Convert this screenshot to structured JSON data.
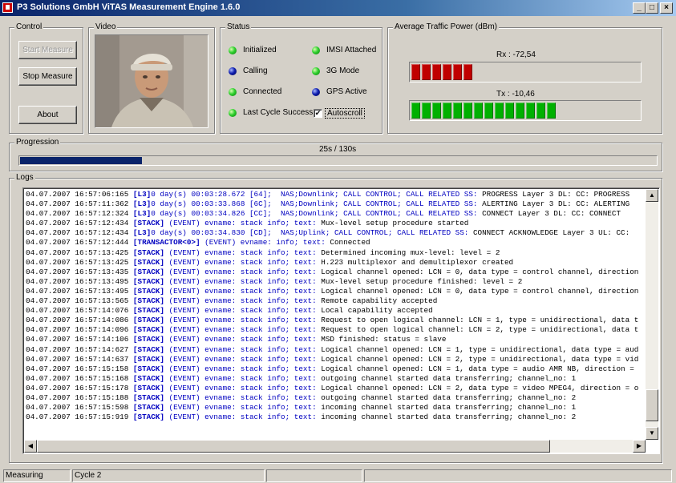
{
  "window": {
    "title": "P3 Solutions GmbH  ViTAS Measurement Engine 1.6.0",
    "controls": [
      "_",
      "□",
      "×"
    ]
  },
  "control": {
    "legend": "Control",
    "start_label": "Start Measure",
    "stop_label": "Stop Measure",
    "about_label": "About"
  },
  "video": {
    "legend": "Video"
  },
  "status": {
    "legend": "Status",
    "items": [
      {
        "label": "Initialized",
        "color": "green"
      },
      {
        "label": "Calling",
        "color": "blue"
      },
      {
        "label": "Connected",
        "color": "green"
      },
      {
        "label": "Last Cycle Success",
        "color": "green"
      },
      {
        "label": "IMSI Attached",
        "color": "green"
      },
      {
        "label": "3G Mode",
        "color": "green"
      },
      {
        "label": "GPS Active",
        "color": "blue"
      }
    ],
    "autoscroll_label": "Autoscroll",
    "autoscroll_checked": true
  },
  "power": {
    "legend": "Average Traffic Power (dBm)",
    "rx_label": "Rx : -72,54",
    "rx_segments": 6,
    "tx_label": "Tx : -10,46",
    "tx_segments": 14,
    "total_segments": 21,
    "rx_color": "#c00000",
    "tx_color": "#00b000"
  },
  "progression": {
    "legend": "Progression",
    "text": "25s / 130s",
    "fraction": 0.192
  },
  "logs": {
    "legend": "Logs",
    "lines": [
      {
        "ts": "04.07.2007 16:57:06:165",
        "tag": "[L3]",
        "ev": "0 day(s) 00:03:28.672 [64];  NAS;Downlink; CALL CONTROL; CALL RELATED SS:",
        "txt": " PROGRESS Layer 3 DL: CC: PROGRESS"
      },
      {
        "ts": "04.07.2007 16:57:11:362",
        "tag": "[L3]",
        "ev": "0 day(s) 00:03:33.868 [6C];  NAS;Downlink; CALL CONTROL; CALL RELATED SS:",
        "txt": " ALERTING Layer 3 DL: CC: ALERTING"
      },
      {
        "ts": "04.07.2007 16:57:12:324",
        "tag": "[L3]",
        "ev": "0 day(s) 00:03:34.826 [CC];  NAS;Downlink; CALL CONTROL; CALL RELATED SS:",
        "txt": " CONNECT Layer 3 DL: CC: CONNECT"
      },
      {
        "ts": "04.07.2007 16:57:12:434",
        "tag": "[STACK]",
        "ev": " (EVENT) evname: stack info; text:",
        "txt": " Mux-level setup procedure started"
      },
      {
        "ts": "04.07.2007 16:57:12:434",
        "tag": "[L3]",
        "ev": "0 day(s) 00:03:34.830 [CD];  NAS;Uplink; CALL CONTROL; CALL RELATED SS:",
        "txt": " CONNECT ACKNOWLEDGE Layer 3 UL: CC:"
      },
      {
        "ts": "04.07.2007 16:57:12:444",
        "tag": "[TRANSACTOR<0>]",
        "ev": " (EVENT) evname: info; text:",
        "txt": " Connected"
      },
      {
        "ts": "04.07.2007 16:57:13:425",
        "tag": "[STACK]",
        "ev": " (EVENT) evname: stack info; text:",
        "txt": " Determined incoming mux-level: level = 2"
      },
      {
        "ts": "04.07.2007 16:57:13:425",
        "tag": "[STACK]",
        "ev": " (EVENT) evname: stack info; text:",
        "txt": " H.223 multiplexor and demultiplexor created"
      },
      {
        "ts": "04.07.2007 16:57:13:435",
        "tag": "[STACK]",
        "ev": " (EVENT) evname: stack info; text:",
        "txt": " Logical channel opened: LCN = 0, data type = control channel, direction"
      },
      {
        "ts": "04.07.2007 16:57:13:495",
        "tag": "[STACK]",
        "ev": " (EVENT) evname: stack info; text:",
        "txt": " Mux-level setup procedure finished: level = 2"
      },
      {
        "ts": "04.07.2007 16:57:13:495",
        "tag": "[STACK]",
        "ev": " (EVENT) evname: stack info; text:",
        "txt": " Logical channel opened: LCN = 0, data type = control channel, direction"
      },
      {
        "ts": "04.07.2007 16:57:13:565",
        "tag": "[STACK]",
        "ev": " (EVENT) evname: stack info; text:",
        "txt": " Remote capability accepted"
      },
      {
        "ts": "04.07.2007 16:57:14:076",
        "tag": "[STACK]",
        "ev": " (EVENT) evname: stack info; text:",
        "txt": " Local capability accepted"
      },
      {
        "ts": "04.07.2007 16:57:14:086",
        "tag": "[STACK]",
        "ev": " (EVENT) evname: stack info; text:",
        "txt": " Request to open logical channel: LCN = 1, type = unidirectional, data t"
      },
      {
        "ts": "04.07.2007 16:57:14:096",
        "tag": "[STACK]",
        "ev": " (EVENT) evname: stack info; text:",
        "txt": " Request to open logical channel: LCN = 2, type = unidirectional, data t"
      },
      {
        "ts": "04.07.2007 16:57:14:106",
        "tag": "[STACK]",
        "ev": " (EVENT) evname: stack info; text:",
        "txt": " MSD finished: status = slave"
      },
      {
        "ts": "04.07.2007 16:57:14:627",
        "tag": "[STACK]",
        "ev": " (EVENT) evname: stack info; text:",
        "txt": " Logical channel opened: LCN = 1, type = unidirectional, data type = aud"
      },
      {
        "ts": "04.07.2007 16:57:14:637",
        "tag": "[STACK]",
        "ev": " (EVENT) evname: stack info; text:",
        "txt": " Logical channel opened: LCN = 2, type = unidirectional, data type = vid"
      },
      {
        "ts": "04.07.2007 16:57:15:158",
        "tag": "[STACK]",
        "ev": " (EVENT) evname: stack info; text:",
        "txt": " Logical channel opened: LCN = 1, data type = audio AMR NB, direction ="
      },
      {
        "ts": "04.07.2007 16:57:15:168",
        "tag": "[STACK]",
        "ev": " (EVENT) evname: stack info; text:",
        "txt": " outgoing channel started data transferring; channel_no: 1"
      },
      {
        "ts": "04.07.2007 16:57:15:178",
        "tag": "[STACK]",
        "ev": " (EVENT) evname: stack info; text:",
        "txt": " Logical channel opened: LCN = 2, data type = video MPEG4, direction = o"
      },
      {
        "ts": "04.07.2007 16:57:15:188",
        "tag": "[STACK]",
        "ev": " (EVENT) evname: stack info; text:",
        "txt": " outgoing channel started data transferring; channel_no: 2"
      },
      {
        "ts": "04.07.2007 16:57:15:598",
        "tag": "[STACK]",
        "ev": " (EVENT) evname: stack info; text:",
        "txt": " incoming channel started data transferring; channel_no: 1"
      },
      {
        "ts": "04.07.2007 16:57:15:919",
        "tag": "[STACK]",
        "ev": " (EVENT) evname: stack info; text:",
        "txt": " incoming channel started data transferring; channel_no: 2"
      }
    ]
  },
  "statusbar": {
    "state": "Measuring",
    "cycle": "Cycle 2"
  }
}
